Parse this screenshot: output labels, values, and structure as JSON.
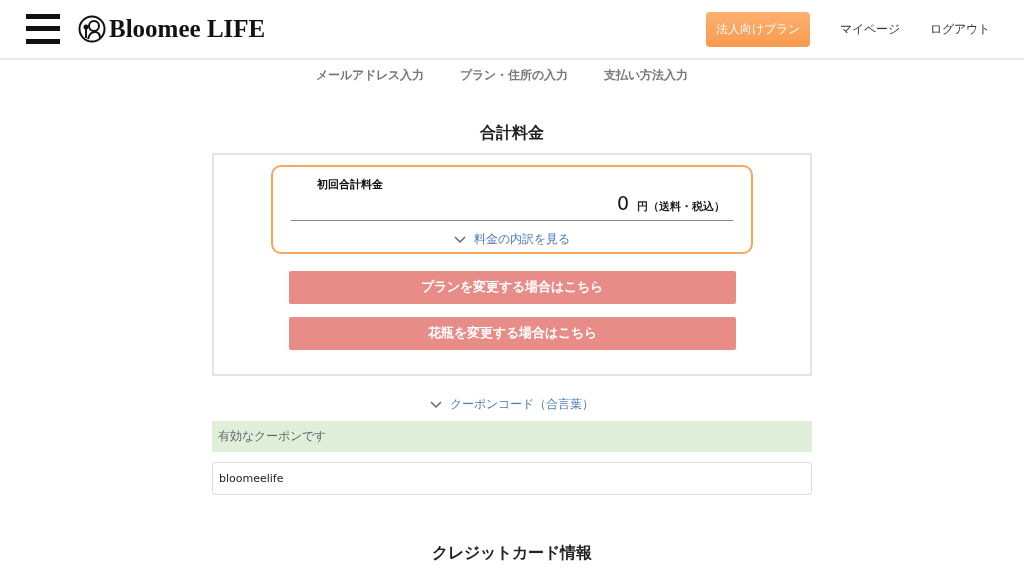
{
  "header": {
    "brand": "Bloomee LIFE",
    "nav": [
      {
        "label": "法人向けプラン",
        "kind": "button"
      },
      {
        "label": "マイページ",
        "kind": "link"
      },
      {
        "label": "ログアウト",
        "kind": "link"
      }
    ]
  },
  "steps": [
    "メールアドレス入力",
    "プラン・住所の入力",
    "支払い方法入力"
  ],
  "total": {
    "title": "合計料金",
    "label": "初回合計料金",
    "amount": "0",
    "unit": "円（送料・税込）",
    "breakdown_link": "料金の内訳を見る",
    "buttons": [
      "プランを変更する場合はこちら",
      "花瓶を変更する場合はこちら"
    ]
  },
  "coupon": {
    "toggle": "クーポンコード（合言葉）",
    "message": "有効なクーポンです",
    "value": "bloomeelife"
  },
  "credit_card": {
    "title": "クレジットカード情報"
  }
}
